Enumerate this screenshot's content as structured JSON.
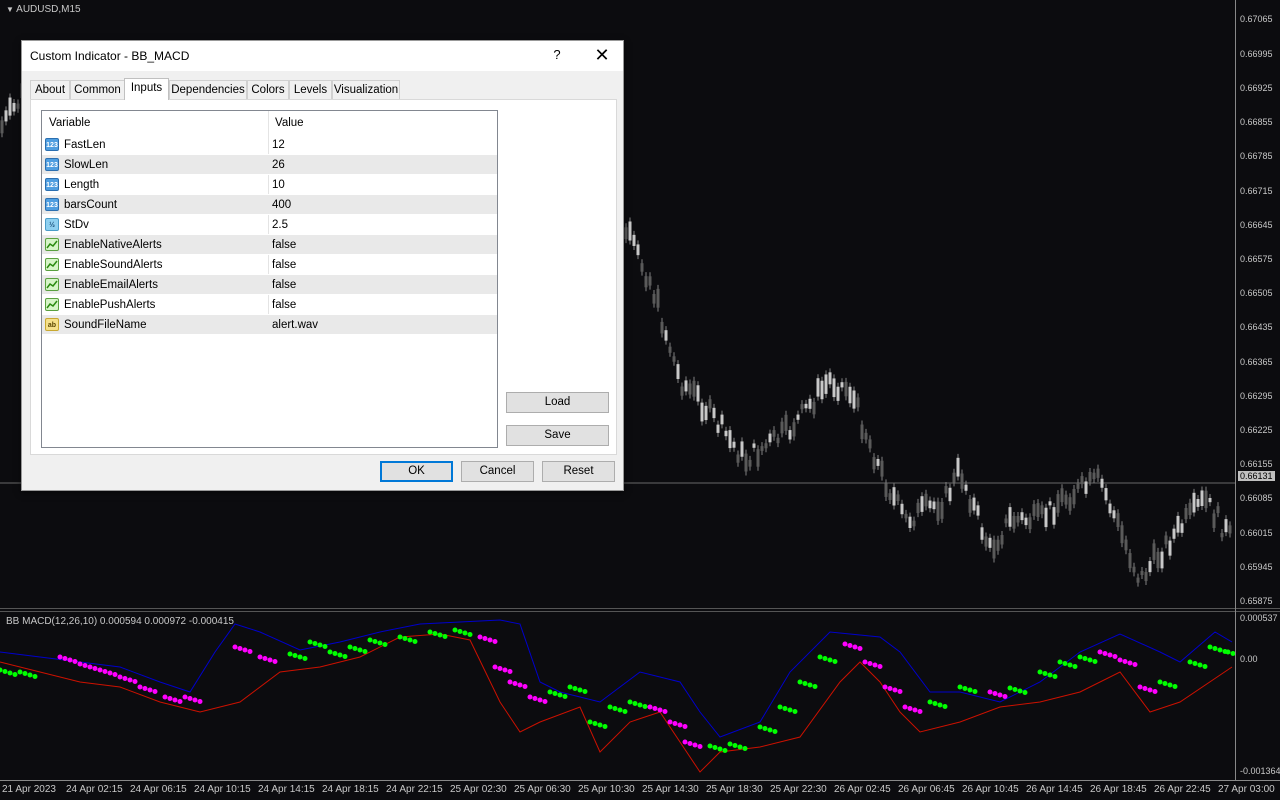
{
  "chart": {
    "symbol": "AUDUSD,M15",
    "indicator_label": "BB MACD(12,26,10) 0.000594 0.000972 -0.000415",
    "price_labels": [
      "0.67065",
      "0.66995",
      "0.66925",
      "0.66855",
      "0.66785",
      "0.66715",
      "0.66645",
      "0.66575",
      "0.66505",
      "0.66435",
      "0.66365",
      "0.66295",
      "0.66225",
      "0.66155",
      "0.66131",
      "0.66085",
      "0.66015",
      "0.65945",
      "0.65875"
    ],
    "current_price": "0.66131",
    "sub_labels": [
      "0.000537",
      "0.00",
      "-0.001364"
    ],
    "time_labels": [
      "21 Apr 2023",
      "24 Apr 02:15",
      "24 Apr 06:15",
      "24 Apr 10:15",
      "24 Apr 14:15",
      "24 Apr 18:15",
      "24 Apr 22:15",
      "25 Apr 02:30",
      "25 Apr 06:30",
      "25 Apr 10:30",
      "25 Apr 14:30",
      "25 Apr 18:30",
      "25 Apr 22:30",
      "26 Apr 02:45",
      "26 Apr 06:45",
      "26 Apr 10:45",
      "26 Apr 14:45",
      "26 Apr 18:45",
      "26 Apr 22:45",
      "27 Apr 03:00"
    ],
    "colors": {
      "bull_dot": "#00ff00",
      "bear_dot": "#ff00ff",
      "upper_band": "#0000cc",
      "lower_band": "#cc1100",
      "candles": "#808080"
    }
  },
  "dialog": {
    "title": "Custom Indicator - BB_MACD",
    "help": "?",
    "close": "✕",
    "tabs": [
      "About",
      "Common",
      "Inputs",
      "Dependencies",
      "Colors",
      "Levels",
      "Visualization"
    ],
    "active_tab": "Inputs",
    "grid": {
      "col_variable": "Variable",
      "col_value": "Value",
      "rows": [
        {
          "icon": "123",
          "type": "num",
          "name": "FastLen",
          "value": "12"
        },
        {
          "icon": "123",
          "type": "num",
          "name": "SlowLen",
          "value": "26"
        },
        {
          "icon": "123",
          "type": "num",
          "name": "Length",
          "value": "10"
        },
        {
          "icon": "123",
          "type": "num",
          "name": "barsCount",
          "value": "400"
        },
        {
          "icon": "½",
          "type": "dbl",
          "name": "StDv",
          "value": "2.5"
        },
        {
          "icon": "bool",
          "type": "bool",
          "name": "EnableNativeAlerts",
          "value": "false"
        },
        {
          "icon": "bool",
          "type": "bool",
          "name": "EnableSoundAlerts",
          "value": "false"
        },
        {
          "icon": "bool",
          "type": "bool",
          "name": "EnableEmailAlerts",
          "value": "false"
        },
        {
          "icon": "bool",
          "type": "bool",
          "name": "EnablePushAlerts",
          "value": "false"
        },
        {
          "icon": "ab",
          "type": "str",
          "name": "SoundFileName",
          "value": "alert.wav"
        }
      ]
    },
    "buttons": {
      "load": "Load",
      "save": "Save",
      "ok": "OK",
      "cancel": "Cancel",
      "reset": "Reset"
    }
  }
}
